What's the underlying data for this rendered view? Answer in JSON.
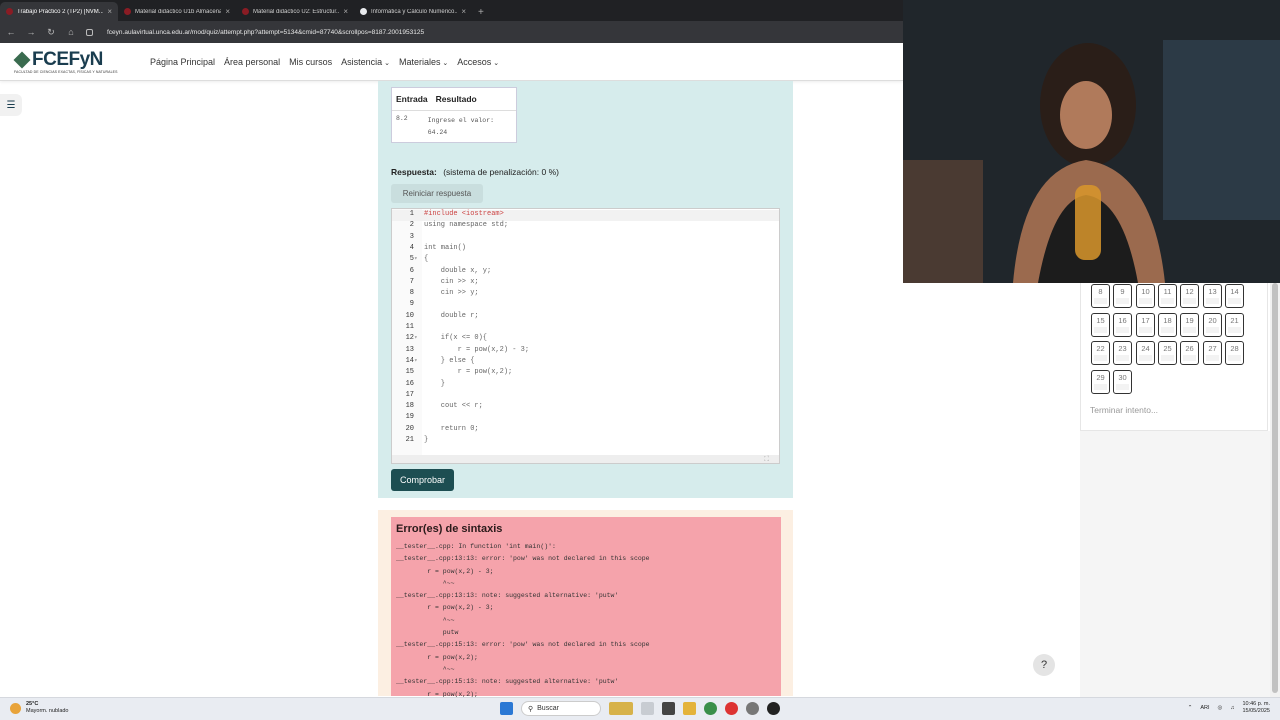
{
  "browser": {
    "tabs": [
      {
        "title": "Trabajo Práctico 2 (TP2) [NVM...",
        "active": true
      },
      {
        "title": "Material didáctico U1b Almacena...",
        "active": false
      },
      {
        "title": "Material didáctico U2: Estructur...",
        "active": false
      },
      {
        "title": "Informática y Cálculo Numérico...",
        "active": false
      }
    ],
    "url": "fceyn.aulavirtual.unca.edu.ar/mod/quiz/attempt.php?attempt=5134&cmid=87740&scrollpos=8187.2001953125"
  },
  "site": {
    "logo_text": "FCEFyN",
    "logo_sub": "FACULTAD DE CIENCIAS EXACTAS, FÍSICAS Y NATURALES",
    "nav": [
      {
        "label": "Página Principal",
        "dropdown": false
      },
      {
        "label": "Área personal",
        "dropdown": false
      },
      {
        "label": "Mis cursos",
        "dropdown": false
      },
      {
        "label": "Asistencia",
        "dropdown": true
      },
      {
        "label": "Materiales",
        "dropdown": true
      },
      {
        "label": "Accesos",
        "dropdown": true
      }
    ]
  },
  "question": {
    "table_headers": [
      "Entrada",
      "Resultado"
    ],
    "table_input": "8.2",
    "table_result_line1": "Ingrese el valor:",
    "table_result_line2": "64.24",
    "answer_label": "Respuesta:",
    "penalty_text": "(sistema de penalización: 0 %)",
    "reset_button": "Reiniciar respuesta",
    "check_button": "Comprobar",
    "code_lines": [
      "#include <iostream>",
      "using namespace std;",
      "",
      "int main()",
      "{",
      "    double x, y;",
      "    cin >> x;",
      "    cin >> y;",
      "",
      "    double r;",
      "",
      "    if(x <= 0){",
      "        r = pow(x,2) - 3;",
      "    } else {",
      "        r = pow(x,2);",
      "    }",
      "",
      "    cout << r;",
      "",
      "    return 0;",
      "}"
    ]
  },
  "errors": {
    "title": "Error(es) de sintaxis",
    "lines": [
      "__tester__.cpp: In function 'int main()':",
      "__tester__.cpp:13:13: error: 'pow' was not declared in this scope",
      "        r = pow(x,2) - 3;",
      "            ^~~",
      "__tester__.cpp:13:13: note: suggested alternative: 'putw'",
      "        r = pow(x,2) - 3;",
      "            ^~~",
      "            putw",
      "__tester__.cpp:15:13: error: 'pow' was not declared in this scope",
      "        r = pow(x,2);",
      "            ^~~",
      "__tester__.cpp:15:13: note: suggested alternative: 'putw'",
      "        r = pow(x,2);"
    ]
  },
  "quiz_nav": {
    "numbers": [
      "8",
      "9",
      "10",
      "11",
      "12",
      "13",
      "14",
      "15",
      "16",
      "17",
      "18",
      "19",
      "20",
      "21",
      "22",
      "23",
      "24",
      "25",
      "26",
      "27",
      "28",
      "29",
      "30"
    ],
    "finish_link": "Terminar intento..."
  },
  "help_label": "?",
  "taskbar": {
    "weather_temp": "25°C",
    "weather_desc": "Mayorm. nublado",
    "search_label": "Buscar",
    "tray_lang": "ARI",
    "time": "10:46 p. m.",
    "date": "15/05/2025"
  },
  "colors": {
    "question_bg": "#d6ecec",
    "error_bg": "#f5a3ab",
    "primary_button": "#1d4e52",
    "brand": "#1a3d4f"
  }
}
